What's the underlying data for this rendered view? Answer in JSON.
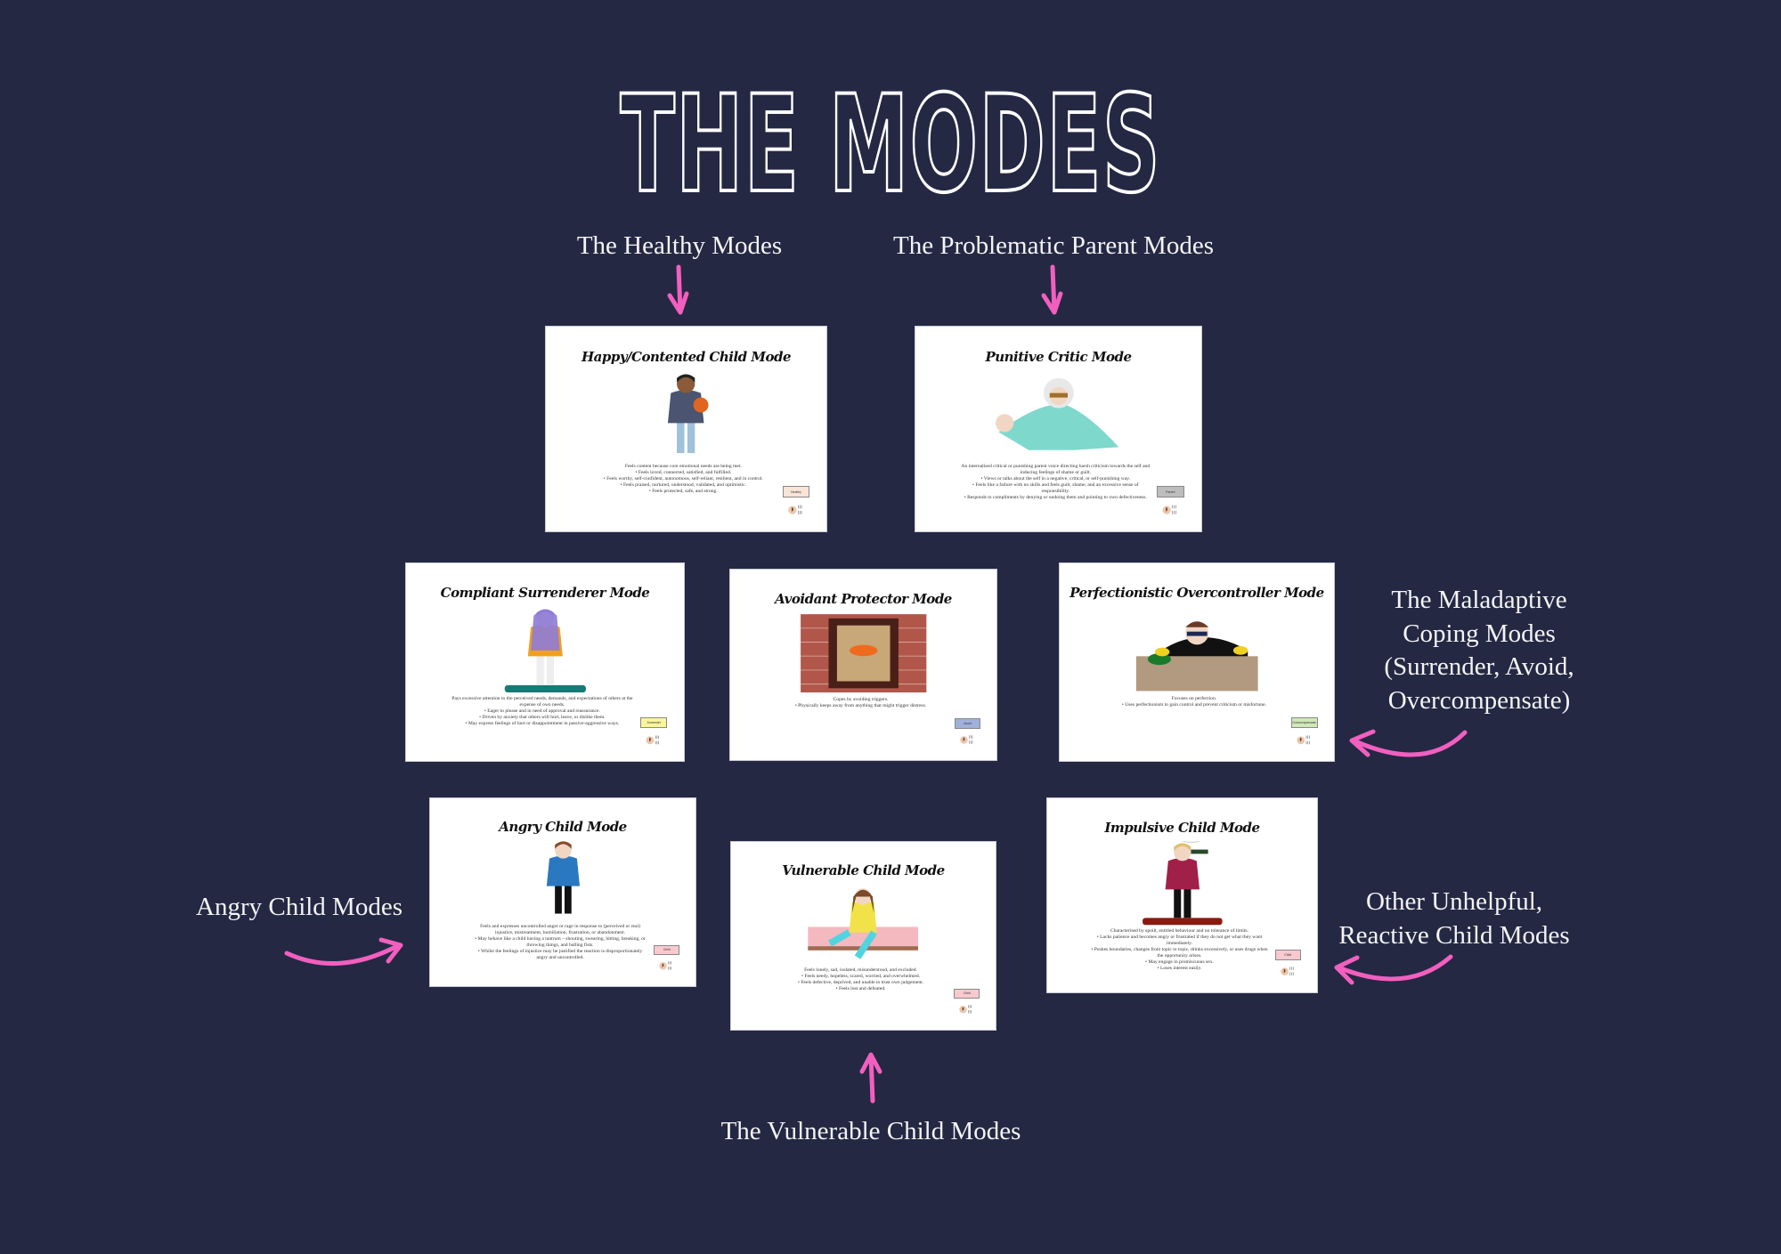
{
  "title": "THE MODES",
  "accent_color": "#f25fbf",
  "background_color": "#242843",
  "labels": {
    "healthy": "The Healthy Modes",
    "parent": "The Problematic Parent Modes",
    "maladaptive": [
      "The Maladaptive",
      "Coping Modes",
      "(Surrender, Avoid,",
      "Overcompensate)"
    ],
    "angry": "Angry Child Modes",
    "other": [
      "Other Unhelpful,",
      "Reactive Child Modes"
    ],
    "vulnerable": "The Vulnerable Child Modes"
  },
  "cards": [
    {
      "title": "Happy/Contented Child Mode",
      "illustration": "boy-with-basketball",
      "badge": "Healthy",
      "badge_color": "#f9e4d8",
      "intro": "Feels content because core emotional needs are being met.",
      "bullets": [
        "Feels loved, connected, satisfied, and fulfilled.",
        "Feels worthy, self-confident, autonomous, self-reliant, resilient, and in control.",
        "Feels praised, nurtured, understood, validated, and optimistic.",
        "Feels protected, safe, and strong."
      ]
    },
    {
      "title": "Punitive Critic Mode",
      "illustration": "angry-old-woman-pointing",
      "badge": "Parent",
      "badge_color": "#bdbdbd",
      "intro": "An internalised critical or punishing parent voice directing harsh criticism towards the self and inducing feelings of shame or guilt.",
      "bullets": [
        "Views or talks about the self in a negative, critical, or self-punishing way.",
        "Feels like a failure with no skills and feels guilt, shame, and an excessive sense of responsibility.",
        "Responds to compliments by denying or undoing them and pointing to own defectiveness."
      ]
    },
    {
      "title": "Compliant Surrenderer Mode",
      "illustration": "girl-in-headscarf",
      "badge": "Surrender",
      "badge_color": "#fbf59a",
      "intro": "Pays excessive attention to the perceived needs, demands, and expectations of others at the expense of own needs.",
      "bullets": [
        "Eager to please and in need of approval and reassurance.",
        "Driven by anxiety that others will hurt, leave, or dislike them.",
        "May express feelings of hurt or disappointment in passive-aggressive ways."
      ]
    },
    {
      "title": "Avoidant Protector Mode",
      "illustration": "boarded-window-brick-wall",
      "badge": "Avoid",
      "badge_color": "#9fb0dc",
      "intro": "Copes by avoiding triggers.",
      "bullets": [
        "Physically keeps away from anything that might trigger distress."
      ]
    },
    {
      "title": "Perfectionistic Overcontroller Mode",
      "illustration": "man-cleaning-table",
      "badge": "Overcompensate",
      "badge_color": "#cfe8b8",
      "intro": "Focuses on perfection.",
      "bullets": [
        "Uses perfectionism to gain control and prevent criticism or misfortune."
      ]
    },
    {
      "title": "Angry Child Mode",
      "illustration": "shouting-girl",
      "badge": "Child",
      "badge_color": "#f8c9cf",
      "intro": "Feels and expresses uncontrolled anger or rage in response to (perceived or real) injustice, mistreatment, humiliation, frustration, or abandonment.",
      "bullets": [
        "May behave like a child having a tantrum – shouting, swearing, hitting, breaking, or throwing things, and balling fists.",
        "Whilst the feelings of injustice may be justified the reaction is disproportionately angry and uncontrolled."
      ]
    },
    {
      "title": "Vulnerable Child Mode",
      "illustration": "sad-girl-sitting",
      "badge": "Child",
      "badge_color": "#f8c9cf",
      "intro": "Feels lonely, sad, isolated, misunderstood, and excluded.",
      "bullets": [
        "Feels needy, hopeless, scared, worried, and overwhelmed.",
        "Feels defective, deprived, and unable to trust own judgement.",
        "Feels lost and defeated."
      ]
    },
    {
      "title": "Impulsive Child Mode",
      "illustration": "woman-drinking-from-bottle",
      "badge": "Child",
      "badge_color": "#f8c9cf",
      "intro": "Characterised by spoilt, entitled behaviour and no tolerance of limits.",
      "bullets": [
        "Lacks patience and becomes angry or frustrated if they do not get what they want immediately.",
        "Pushes boundaries, changes from topic to topic, drinks excessively, or uses drugs when the opportunity arises.",
        "May engage in promiscuous sex.",
        "Loses interest easily."
      ]
    }
  ]
}
